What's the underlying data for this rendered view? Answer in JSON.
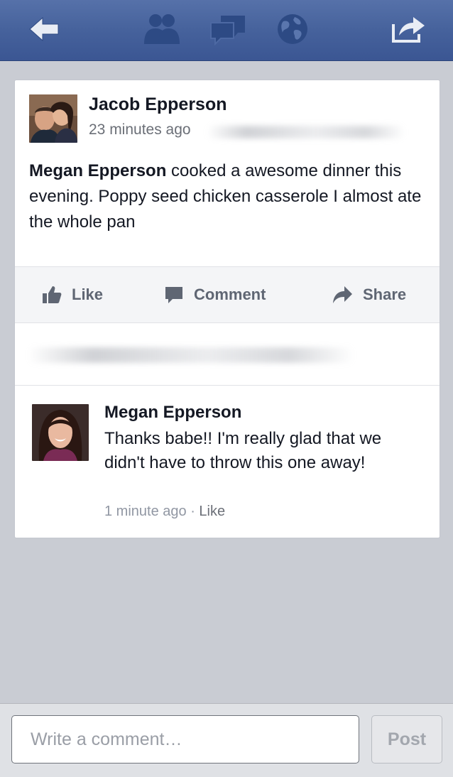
{
  "navbar": {
    "icons": [
      "back-arrow-icon",
      "friends-icon",
      "messages-icon",
      "notifications-globe-icon",
      "share-out-icon"
    ]
  },
  "post": {
    "author": "Jacob Epperson",
    "time": "23 minutes ago",
    "mention": "Megan Epperson",
    "text": " cooked a awesome dinner this evening. Poppy seed chicken casserole I almost ate the whole pan"
  },
  "actions": {
    "like_label": "Like",
    "comment_label": "Comment",
    "share_label": "Share"
  },
  "comment": {
    "author": "Megan Epperson",
    "text": "Thanks babe!!  I'm really glad that we didn't have to throw this one away!",
    "time": "1 minute ago",
    "separator": " · ",
    "like_label": "Like"
  },
  "composer": {
    "placeholder": "Write a comment…",
    "post_label": "Post"
  },
  "colors": {
    "navbar": "#3b5693",
    "background": "#c9ccd3",
    "action_text": "#5f6673"
  }
}
